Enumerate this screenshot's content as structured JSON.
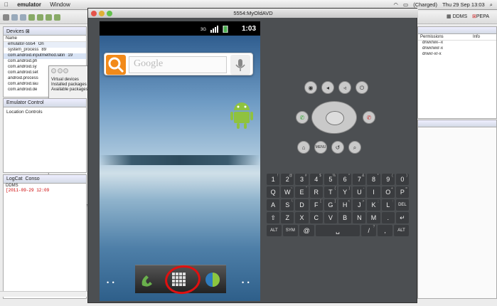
{
  "menubar": {
    "app_name": "emulator",
    "menu_window": "Window",
    "status_text": "(Charged)",
    "clock": "Thu 29 Sep 13:03"
  },
  "eclipse": {
    "devices_tab": "Devices",
    "ddms_label": "DDMS",
    "pepa_label": "PEPA",
    "device_columns": [
      "Name",
      "On"
    ],
    "device_rows": [
      {
        "name": "emulator-5554",
        "val": "On"
      },
      {
        "name": "system_process",
        "val": "89"
      },
      {
        "name": "com.android.inputmethod.latin",
        "val": "19"
      },
      {
        "name": "com.android.ph",
        "val": ""
      },
      {
        "name": "com.android.sy",
        "val": ""
      },
      {
        "name": "com.android.set",
        "val": ""
      },
      {
        "name": "android.process",
        "val": ""
      },
      {
        "name": "com.android.lau",
        "val": ""
      },
      {
        "name": "com.android.de",
        "val": ""
      }
    ],
    "popup_items": [
      "Virtual devices",
      "Installed packages",
      "Available packages"
    ],
    "emulator_control_tab": "Emulator Control",
    "location_controls": "Location Controls",
    "logcat_tab": "LogCat",
    "console_tab": "Conso",
    "log_source": "DDMS",
    "log_line": "[2011-09-29 12:09",
    "right_columns": [
      "Permissions",
      "Info"
    ],
    "permissions": [
      "drwxrwx--x",
      "drwxrwxr-x",
      "drwxr-xr-x"
    ]
  },
  "emulator": {
    "title": "5554:MyOldAVD",
    "clock": "1:03",
    "search_placeholder": "Google",
    "home_dots_left": "• •",
    "home_dots_right": "• •",
    "menu_button": "MENU",
    "keyboard": [
      [
        {
          "k": "1",
          "s": "!"
        },
        {
          "k": "2",
          "s": "@"
        },
        {
          "k": "3",
          "s": "#"
        },
        {
          "k": "4",
          "s": "$"
        },
        {
          "k": "5",
          "s": "%"
        },
        {
          "k": "6",
          "s": "^"
        },
        {
          "k": "7",
          "s": "&"
        },
        {
          "k": "8",
          "s": "*"
        },
        {
          "k": "9",
          "s": "("
        },
        {
          "k": "0",
          "s": ")"
        }
      ],
      [
        {
          "k": "Q",
          "s": ""
        },
        {
          "k": "W",
          "s": "~"
        },
        {
          "k": "E",
          "s": "\""
        },
        {
          "k": "R",
          "s": ""
        },
        {
          "k": "T",
          "s": "{"
        },
        {
          "k": "Y",
          "s": "}"
        },
        {
          "k": "U",
          "s": "-"
        },
        {
          "k": "I",
          "s": ""
        },
        {
          "k": "O",
          "s": "+"
        },
        {
          "k": "P",
          "s": "="
        }
      ],
      [
        {
          "k": "A",
          "s": ""
        },
        {
          "k": "S",
          "s": "\\"
        },
        {
          "k": "D",
          "s": ""
        },
        {
          "k": "F",
          "s": "["
        },
        {
          "k": "G",
          "s": "]"
        },
        {
          "k": "H",
          "s": "<"
        },
        {
          "k": "J",
          "s": ">"
        },
        {
          "k": "K",
          "s": ";"
        },
        {
          "k": "L",
          "s": ":"
        },
        {
          "k": "DEL",
          "s": ""
        }
      ],
      [
        {
          "k": "⇧",
          "s": ""
        },
        {
          "k": "Z",
          "s": ""
        },
        {
          "k": "X",
          "s": ""
        },
        {
          "k": "C",
          "s": ""
        },
        {
          "k": "V",
          "s": ""
        },
        {
          "k": "B",
          "s": ""
        },
        {
          "k": "N",
          "s": ""
        },
        {
          "k": "M",
          "s": ""
        },
        {
          "k": ".",
          "s": ""
        },
        {
          "k": "↵",
          "s": ""
        }
      ],
      [
        {
          "k": "ALT",
          "s": ""
        },
        {
          "k": "SYM",
          "s": ""
        },
        {
          "k": "@",
          "s": ""
        },
        {
          "k": "␣",
          "s": ""
        },
        {
          "k": "/",
          "s": "?"
        },
        {
          "k": ",",
          "s": ""
        },
        {
          "k": "ALT",
          "s": ""
        }
      ]
    ]
  },
  "colors": {
    "emulator_bg": "#4c4f52",
    "annotation_red": "#e01010",
    "search_orange": "#f28a1a"
  }
}
